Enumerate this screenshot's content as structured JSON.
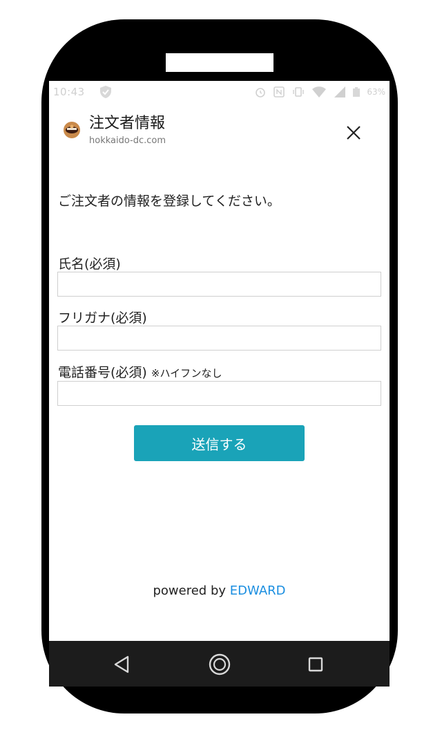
{
  "status_bar": {
    "time": "10:43",
    "battery": "63%"
  },
  "dialog": {
    "title": "注文者情報",
    "domain": "hokkaido-dc.com",
    "close_icon": "close-icon",
    "favicon_icon": "site-favicon-icon"
  },
  "form": {
    "intro": "ご注文者の情報を登録してください。",
    "fields": [
      {
        "label": "氏名(必須)",
        "note": "",
        "value": ""
      },
      {
        "label": "フリガナ(必須)",
        "note": "",
        "value": ""
      },
      {
        "label": "電話番号(必須)",
        "note": "※ハイフンなし",
        "value": ""
      }
    ],
    "submit_label": "送信する"
  },
  "footer": {
    "powered_by": "powered by",
    "brand": "EDWARD"
  },
  "navigation": {
    "back_icon": "back-triangle-icon",
    "home_icon": "home-circle-icon",
    "recents_icon": "recents-square-icon"
  },
  "colors": {
    "accent": "#1aa3b8",
    "link": "#1a8ee0",
    "navbar": "#1c1c1c"
  }
}
